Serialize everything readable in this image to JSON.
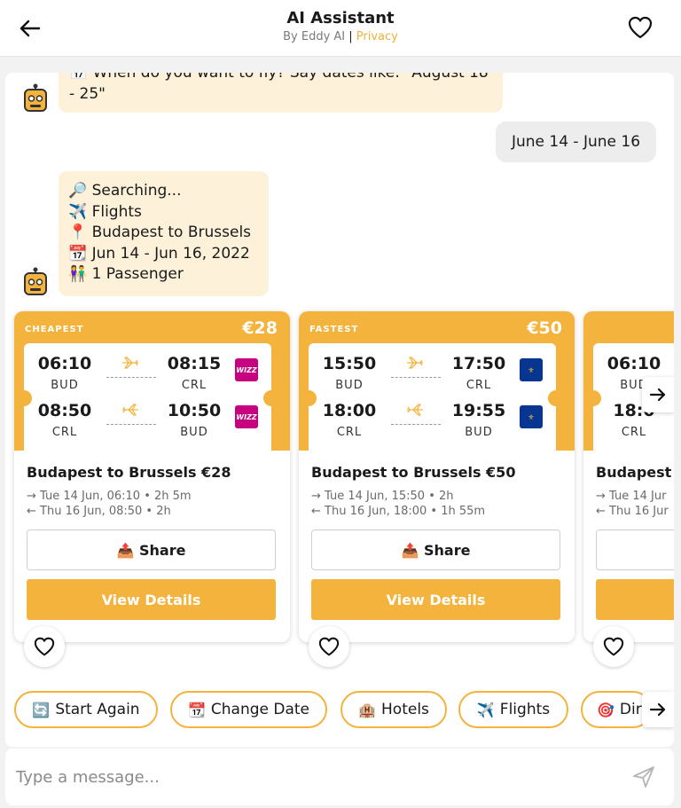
{
  "header": {
    "title": "AI Assistant",
    "by": "By Eddy AI",
    "separator": "|",
    "privacy": "Privacy"
  },
  "chat": {
    "bot_msg_1": {
      "line_1": "📅 When do you want to fly? Say dates like: \"August 18",
      "line_2": "- 25\""
    },
    "user_msg_1": "June 14 - June 16",
    "bot_msg_2": [
      "🔎 Searching...",
      "✈️ Flights",
      "📍 Budapest to Brussels",
      "📆 Jun 14 - Jun 16, 2022",
      "👫 1 Passenger"
    ]
  },
  "cards": [
    {
      "tag": "CHEAPEST",
      "price": "€28",
      "outbound": {
        "dep_time": "06:10",
        "dep_code": "BUD",
        "arr_time": "08:15",
        "arr_code": "CRL",
        "airline": "wizz-air-logo",
        "airline_label": "WIZZ"
      },
      "inbound": {
        "dep_time": "08:50",
        "dep_code": "CRL",
        "arr_time": "10:50",
        "arr_code": "BUD",
        "airline": "wizz-air-logo",
        "airline_label": "WIZZ"
      },
      "title": "Budapest to Brussels €28",
      "line_out": "→ Tue 14 Jun, 06:10 • 2h 5m",
      "line_in": "← Thu 16 Jun, 08:50 • 2h",
      "share_label": "📤 Share",
      "details_label": "View Details"
    },
    {
      "tag": "FASTEST",
      "price": "€50",
      "outbound": {
        "dep_time": "15:50",
        "dep_code": "BUD",
        "arr_time": "17:50",
        "arr_code": "CRL",
        "airline": "ryanair-logo",
        "airline_label": "⚜"
      },
      "inbound": {
        "dep_time": "18:00",
        "dep_code": "CRL",
        "arr_time": "19:55",
        "arr_code": "BUD",
        "airline": "ryanair-logo",
        "airline_label": "⚜"
      },
      "title": "Budapest to Brussels €50",
      "line_out": "→ Tue 14 Jun, 15:50 • 2h",
      "line_in": "← Thu 16 Jun, 18:00 • 1h 55m",
      "share_label": "📤 Share",
      "details_label": "View Details"
    },
    {
      "tag": "",
      "price": "",
      "outbound": {
        "dep_time": "06:10",
        "dep_code": "BUD",
        "arr_time": "",
        "arr_code": "",
        "airline": "",
        "airline_label": ""
      },
      "inbound": {
        "dep_time": "18:0",
        "dep_code": "CRL",
        "arr_time": "",
        "arr_code": "",
        "airline": "",
        "airline_label": ""
      },
      "title": "Budapest t",
      "line_out": "→ Tue 14 Jur",
      "line_in": "← Thu 16 Jur",
      "share_label": "",
      "details_label": ""
    }
  ],
  "quick_replies": [
    {
      "emoji": "🔄",
      "label": "Start Again"
    },
    {
      "emoji": "📆",
      "label": "Change Date"
    },
    {
      "emoji": "🏨",
      "label": "Hotels"
    },
    {
      "emoji": "✈️",
      "label": "Flights"
    },
    {
      "emoji": "🎯",
      "label": "Dir"
    }
  ],
  "input": {
    "placeholder": "Type a message..."
  },
  "colors": {
    "accent": "#f3b33d",
    "bot_bubble": "#fdf1d9",
    "user_bubble": "#ededed",
    "wizz": "#c6007e",
    "ryanair": "#073590"
  }
}
